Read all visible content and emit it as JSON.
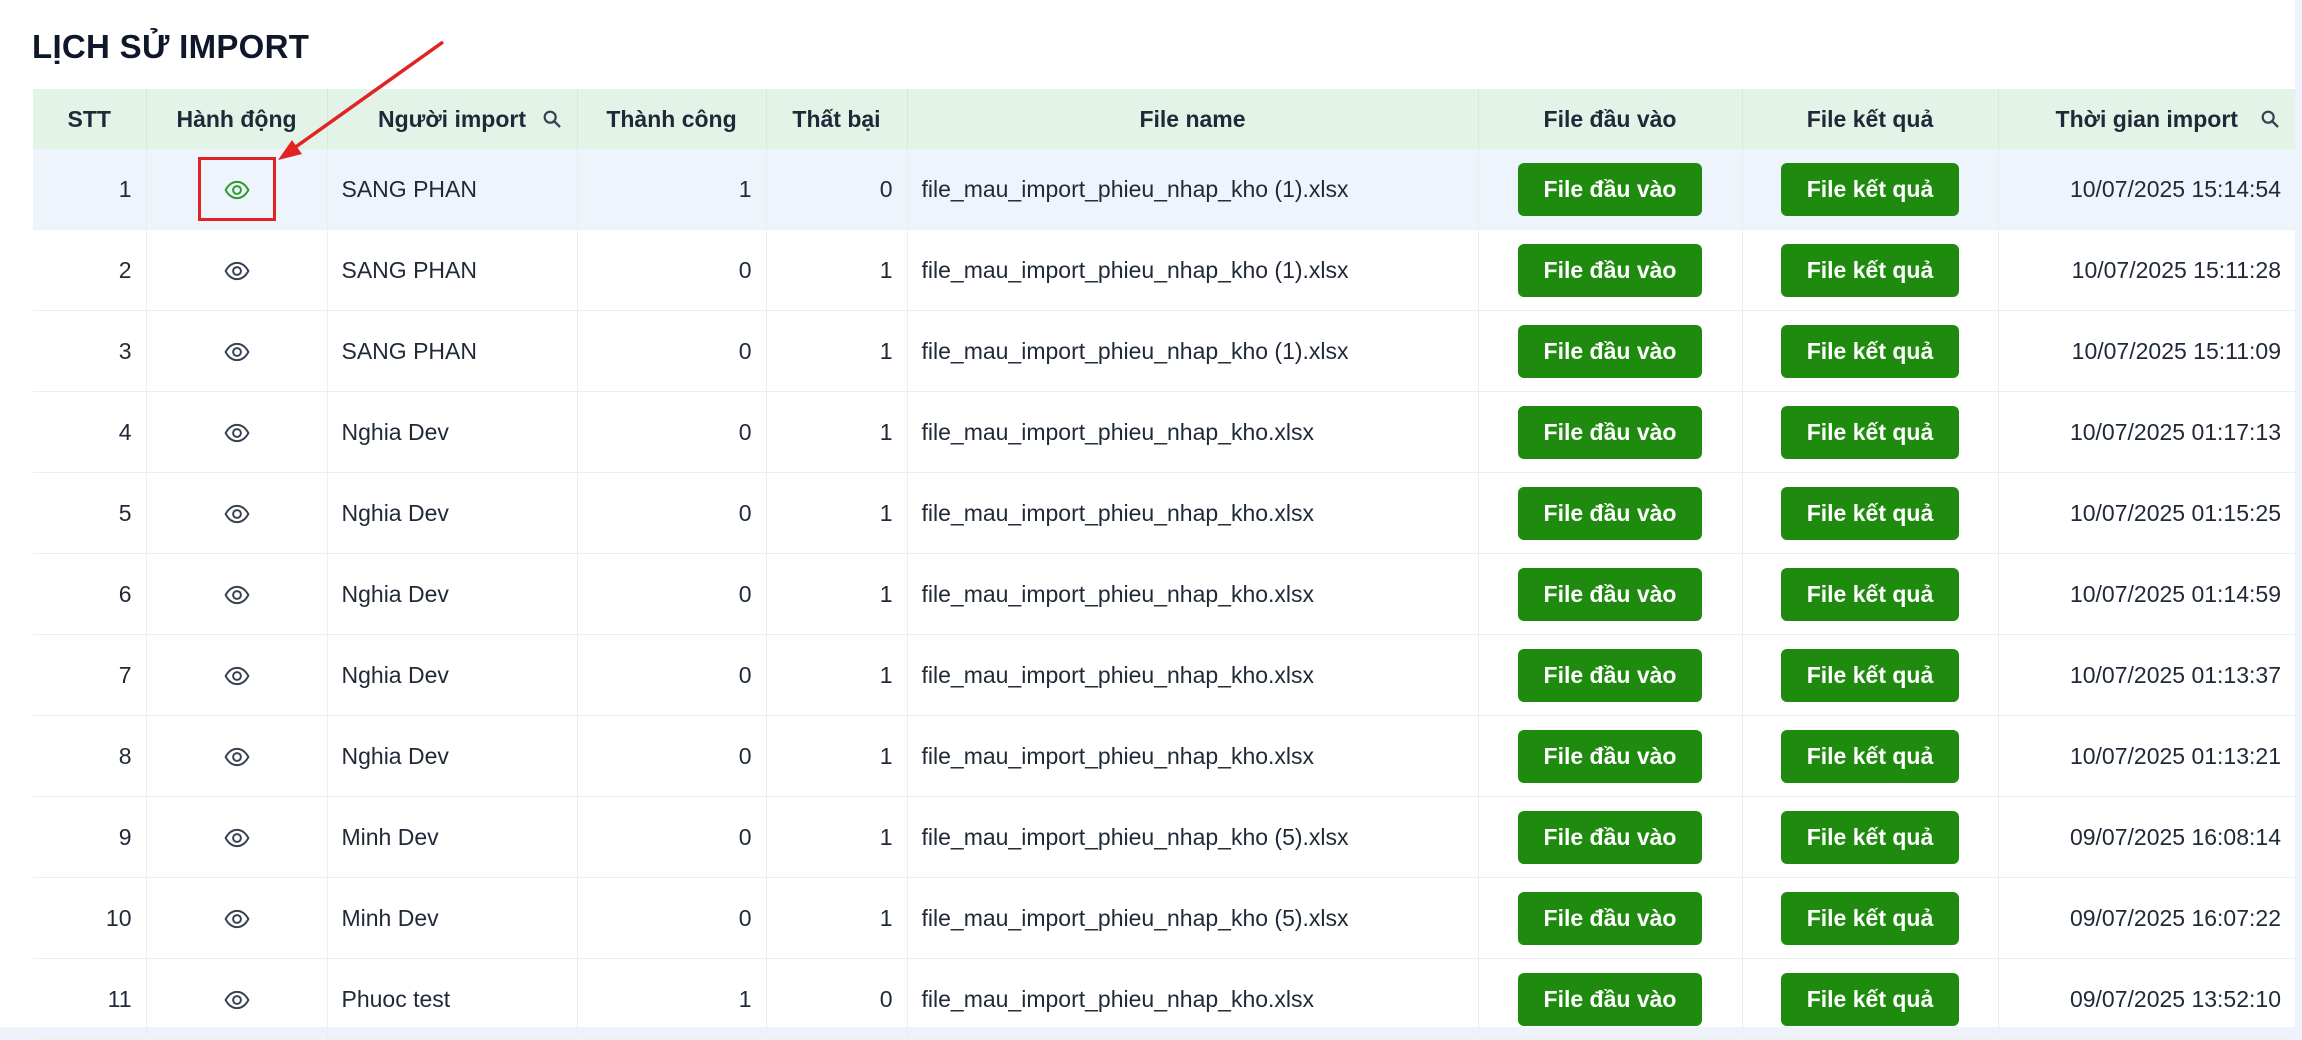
{
  "page": {
    "title": "LỊCH SỬ IMPORT"
  },
  "colors": {
    "accent_button": "#1f8b0e",
    "header_bg": "#e3f3e8",
    "selected_row_bg": "#eef4fb",
    "annotation": "#e02424"
  },
  "table": {
    "headers": {
      "stt": "STT",
      "action": "Hành động",
      "user": "Người import",
      "success": "Thành công",
      "failed": "Thất bại",
      "file_name": "File name",
      "input_file": "File đầu vào",
      "result_file": "File kết quả",
      "time": "Thời gian import"
    },
    "header_icons": {
      "user": "search-icon",
      "time": "search-icon"
    },
    "row_icon": "eye-icon",
    "rows": [
      {
        "stt": "1",
        "user": "SANG PHAN",
        "success": "1",
        "failed": "0",
        "file_name": "file_mau_import_phieu_nhap_kho (1).xlsx",
        "input_btn": "File đầu vào",
        "result_btn": "File kết quả",
        "time": "10/07/2025 15:14:54"
      },
      {
        "stt": "2",
        "user": "SANG PHAN",
        "success": "0",
        "failed": "1",
        "file_name": "file_mau_import_phieu_nhap_kho (1).xlsx",
        "input_btn": "File đầu vào",
        "result_btn": "File kết quả",
        "time": "10/07/2025 15:11:28"
      },
      {
        "stt": "3",
        "user": "SANG PHAN",
        "success": "0",
        "failed": "1",
        "file_name": "file_mau_import_phieu_nhap_kho (1).xlsx",
        "input_btn": "File đầu vào",
        "result_btn": "File kết quả",
        "time": "10/07/2025 15:11:09"
      },
      {
        "stt": "4",
        "user": "Nghia Dev",
        "success": "0",
        "failed": "1",
        "file_name": "file_mau_import_phieu_nhap_kho.xlsx",
        "input_btn": "File đầu vào",
        "result_btn": "File kết quả",
        "time": "10/07/2025 01:17:13"
      },
      {
        "stt": "5",
        "user": "Nghia Dev",
        "success": "0",
        "failed": "1",
        "file_name": "file_mau_import_phieu_nhap_kho.xlsx",
        "input_btn": "File đầu vào",
        "result_btn": "File kết quả",
        "time": "10/07/2025 01:15:25"
      },
      {
        "stt": "6",
        "user": "Nghia Dev",
        "success": "0",
        "failed": "1",
        "file_name": "file_mau_import_phieu_nhap_kho.xlsx",
        "input_btn": "File đầu vào",
        "result_btn": "File kết quả",
        "time": "10/07/2025 01:14:59"
      },
      {
        "stt": "7",
        "user": "Nghia Dev",
        "success": "0",
        "failed": "1",
        "file_name": "file_mau_import_phieu_nhap_kho.xlsx",
        "input_btn": "File đầu vào",
        "result_btn": "File kết quả",
        "time": "10/07/2025 01:13:37"
      },
      {
        "stt": "8",
        "user": "Nghia Dev",
        "success": "0",
        "failed": "1",
        "file_name": "file_mau_import_phieu_nhap_kho.xlsx",
        "input_btn": "File đầu vào",
        "result_btn": "File kết quả",
        "time": "10/07/2025 01:13:21"
      },
      {
        "stt": "9",
        "user": "Minh Dev",
        "success": "0",
        "failed": "1",
        "file_name": "file_mau_import_phieu_nhap_kho (5).xlsx",
        "input_btn": "File đầu vào",
        "result_btn": "File kết quả",
        "time": "09/07/2025 16:08:14"
      },
      {
        "stt": "10",
        "user": "Minh Dev",
        "success": "0",
        "failed": "1",
        "file_name": "file_mau_import_phieu_nhap_kho (5).xlsx",
        "input_btn": "File đầu vào",
        "result_btn": "File kết quả",
        "time": "09/07/2025 16:07:22"
      },
      {
        "stt": "11",
        "user": "Phuoc test",
        "success": "1",
        "failed": "0",
        "file_name": "file_mau_import_phieu_nhap_kho.xlsx",
        "input_btn": "File đầu vào",
        "result_btn": "File kết quả",
        "time": "09/07/2025 13:52:10"
      }
    ]
  }
}
